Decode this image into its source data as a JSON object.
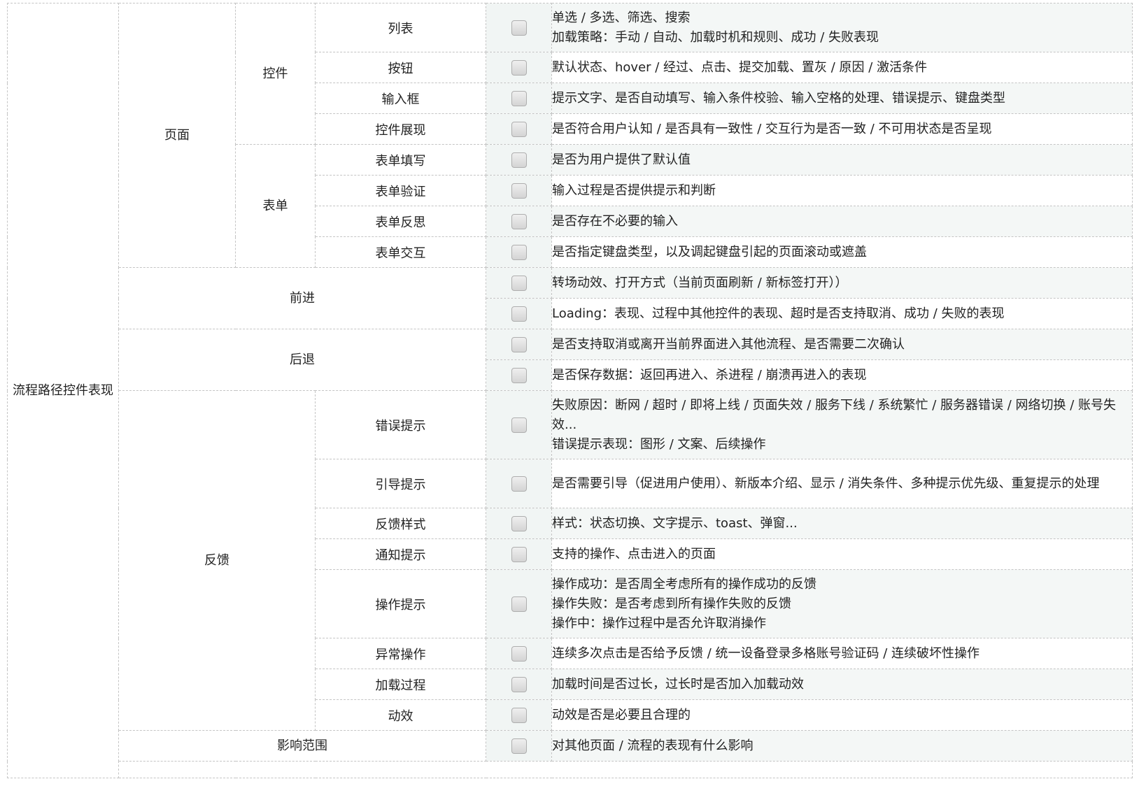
{
  "root_label": "流程路径控件表现",
  "groups": {
    "page": "页面",
    "controls": "控件",
    "form": "表单",
    "forward": "前进",
    "back": "后退",
    "feedback": "反馈",
    "impact": "影响范围"
  },
  "rows": [
    {
      "item": "列表",
      "checked": false,
      "desc": [
        "单选 / 多选、筛选、搜索",
        "加载策略：手动 / 自动、加载时机和规则、成功 / 失败表现"
      ]
    },
    {
      "item": "按钮",
      "checked": false,
      "desc": [
        "默认状态、hover / 经过、点击、提交加载、置灰 / 原因 / 激活条件"
      ]
    },
    {
      "item": "输入框",
      "checked": false,
      "desc": [
        "提示文字、是否自动填写、输入条件校验、输入空格的处理、错误提示、键盘类型"
      ]
    },
    {
      "item": "控件展现",
      "checked": false,
      "desc": [
        "是否符合用户认知 / 是否具有一致性 / 交互行为是否一致 / 不可用状态是否呈现"
      ]
    },
    {
      "item": "表单填写",
      "checked": false,
      "desc": [
        "是否为用户提供了默认值"
      ]
    },
    {
      "item": "表单验证",
      "checked": false,
      "desc": [
        "输入过程是否提供提示和判断"
      ]
    },
    {
      "item": "表单反思",
      "checked": false,
      "desc": [
        "是否存在不必要的输入"
      ]
    },
    {
      "item": "表单交互",
      "checked": false,
      "desc": [
        "是否指定键盘类型，以及调起键盘引起的页面滚动或遮盖"
      ]
    },
    {
      "item": "",
      "checked": false,
      "desc": [
        "转场动效、打开方式（当前页面刷新 / 新标签打开））"
      ]
    },
    {
      "item": "",
      "checked": false,
      "desc": [
        "Loading：表现、过程中其他控件的表现、超时是否支持取消、成功 / 失败的表现"
      ]
    },
    {
      "item": "",
      "checked": false,
      "desc": [
        "是否支持取消或离开当前界面进入其他流程、是否需要二次确认"
      ]
    },
    {
      "item": "",
      "checked": false,
      "desc": [
        "是否保存数据：返回再进入、杀进程 / 崩溃再进入的表现"
      ]
    },
    {
      "item": "错误提示",
      "checked": false,
      "desc": [
        "失败原因：断网 / 超时 / 即将上线 / 页面失效 / 服务下线 / 系统繁忙 / 服务器错误 / 网络切换 / 账号失效...",
        "错误提示表现：图形 / 文案、后续操作"
      ]
    },
    {
      "item": "引导提示",
      "checked": false,
      "desc": [
        "是否需要引导（促进用户使用）、新版本介绍、显示 / 消失条件、多种提示优先级、重复提示的处理"
      ]
    },
    {
      "item": "反馈样式",
      "checked": false,
      "desc": [
        "样式：状态切换、文字提示、toast、弹窗..."
      ]
    },
    {
      "item": "通知提示",
      "checked": false,
      "desc": [
        "支持的操作、点击进入的页面"
      ]
    },
    {
      "item": "操作提示",
      "checked": false,
      "desc": [
        "操作成功：是否周全考虑所有的操作成功的反馈",
        "操作失败：是否考虑到所有操作失败的反馈",
        "操作中：操作过程中是否允许取消操作"
      ]
    },
    {
      "item": "异常操作",
      "checked": false,
      "desc": [
        "连续多次点击是否给予反馈 / 统一设备登录多格账号验证码 / 连续破坏性操作"
      ]
    },
    {
      "item": "加载过程",
      "checked": false,
      "desc": [
        "加载时间是否过长，过长时是否加入加载动效"
      ]
    },
    {
      "item": "动效",
      "checked": false,
      "desc": [
        "动效是否是必要且合理的"
      ]
    },
    {
      "item": "",
      "checked": false,
      "desc": [
        "对其他页面 / 流程的表现有什么影响"
      ]
    }
  ]
}
